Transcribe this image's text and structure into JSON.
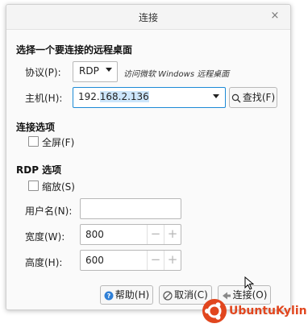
{
  "window": {
    "title": "连接",
    "close_glyph": "×"
  },
  "connect_section": {
    "heading": "选择一个要连接的远程桌面",
    "protocol": {
      "label": "协议(P):",
      "value": "RDP",
      "hint": "访问微软 Windows 远程桌面"
    },
    "host": {
      "label": "主机(H):",
      "value_plain": "192.",
      "value_selected": "168.2.136",
      "find_label": "查找(F)"
    }
  },
  "connect_options": {
    "heading": "连接选项",
    "fullscreen_label": "全屏(F)",
    "fullscreen_checked": false
  },
  "rdp_options": {
    "heading": "RDP 选项",
    "scale_label": "缩放(S)",
    "scale_checked": false,
    "username_label": "用户名(N):",
    "username_value": "",
    "width_label": "宽度(W):",
    "width_value": "800",
    "height_label": "高度(H):",
    "height_value": "600",
    "spin_minus": "−",
    "spin_plus": "+"
  },
  "buttons": {
    "help": "帮助(H)",
    "cancel": "取消(C)",
    "connect": "连接(O)"
  },
  "watermark": {
    "text": "UbuntuKylin",
    "color": "#e1461e"
  },
  "colors": {
    "accent": "#1d8ad6",
    "selection": "#cde6fb"
  }
}
